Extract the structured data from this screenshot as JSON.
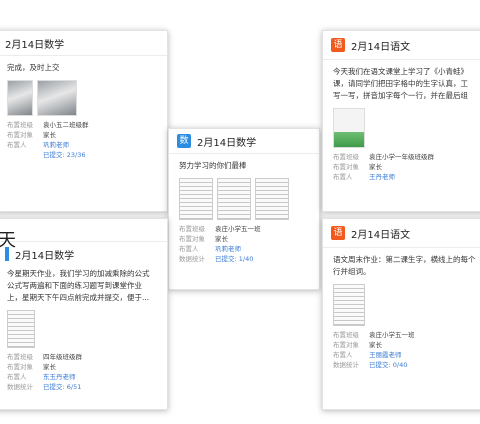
{
  "cards": [
    {
      "id": "c1",
      "date_title": "2月14日数学",
      "subject_badge": "",
      "body": "完成，及时上交",
      "meta": [
        {
          "label": "布置班级",
          "value": "袁小五二班级群"
        },
        {
          "label": "布置对象",
          "value": "家长"
        },
        {
          "label": "布置人",
          "value": "巩莉老师"
        },
        {
          "label": "",
          "value": "已提交: 23/36"
        }
      ]
    },
    {
      "id": "c2",
      "date_title": "2月14日数学",
      "subject_badge": "数",
      "body": "努力学习的你们最棒",
      "meta": [
        {
          "label": "布置班级",
          "value": "袁庄小学五一班"
        },
        {
          "label": "布置对象",
          "value": "家长"
        },
        {
          "label": "布置人",
          "value": "巩莉老师"
        },
        {
          "label": "数据统计",
          "value": "已提交: 1/40"
        }
      ]
    },
    {
      "id": "c3",
      "date_title": "2月14日语文",
      "subject_badge": "语",
      "body_lines": [
        "今天我们在语文课堂上学习了《小青蛙》",
        "课，请同学们把田字格中的生字认真，工",
        "写一写，拼音加字每个一行，并在最后组"
      ],
      "meta": [
        {
          "label": "布置班级",
          "value": "袁庄小学一年级班级群"
        },
        {
          "label": "布置对象",
          "value": "家长"
        },
        {
          "label": "布置人",
          "value": "王丹老师"
        }
      ]
    },
    {
      "id": "c4",
      "big_day": "天",
      "date_title": "2月14日数学",
      "body_lines": [
        "今星期天作业，我们学习的加减乘除的公式",
        "公式写两遍和下面的练习题写到课堂作业",
        "上，星期天下午四点前完成并提交，便于..."
      ],
      "meta": [
        {
          "label": "布置班级",
          "value": "四年级班级群"
        },
        {
          "label": "布置对象",
          "value": "家长"
        },
        {
          "label": "布置人",
          "value": "东玉丹老师"
        },
        {
          "label": "数据统计",
          "value": "已提交: 6/51"
        }
      ]
    },
    {
      "id": "c5",
      "date_title": "2月14日语文",
      "subject_badge": "语",
      "body_lines": [
        "语文周末作业：第二课生字，横线上的每个",
        "行并组词。"
      ],
      "meta": [
        {
          "label": "布置班级",
          "value": "袁庄小学五一班"
        },
        {
          "label": "布置对象",
          "value": "家长"
        },
        {
          "label": "布置人",
          "value": "王丽霞老师"
        },
        {
          "label": "数据统计",
          "value": "已提交: 0/40"
        }
      ]
    }
  ]
}
